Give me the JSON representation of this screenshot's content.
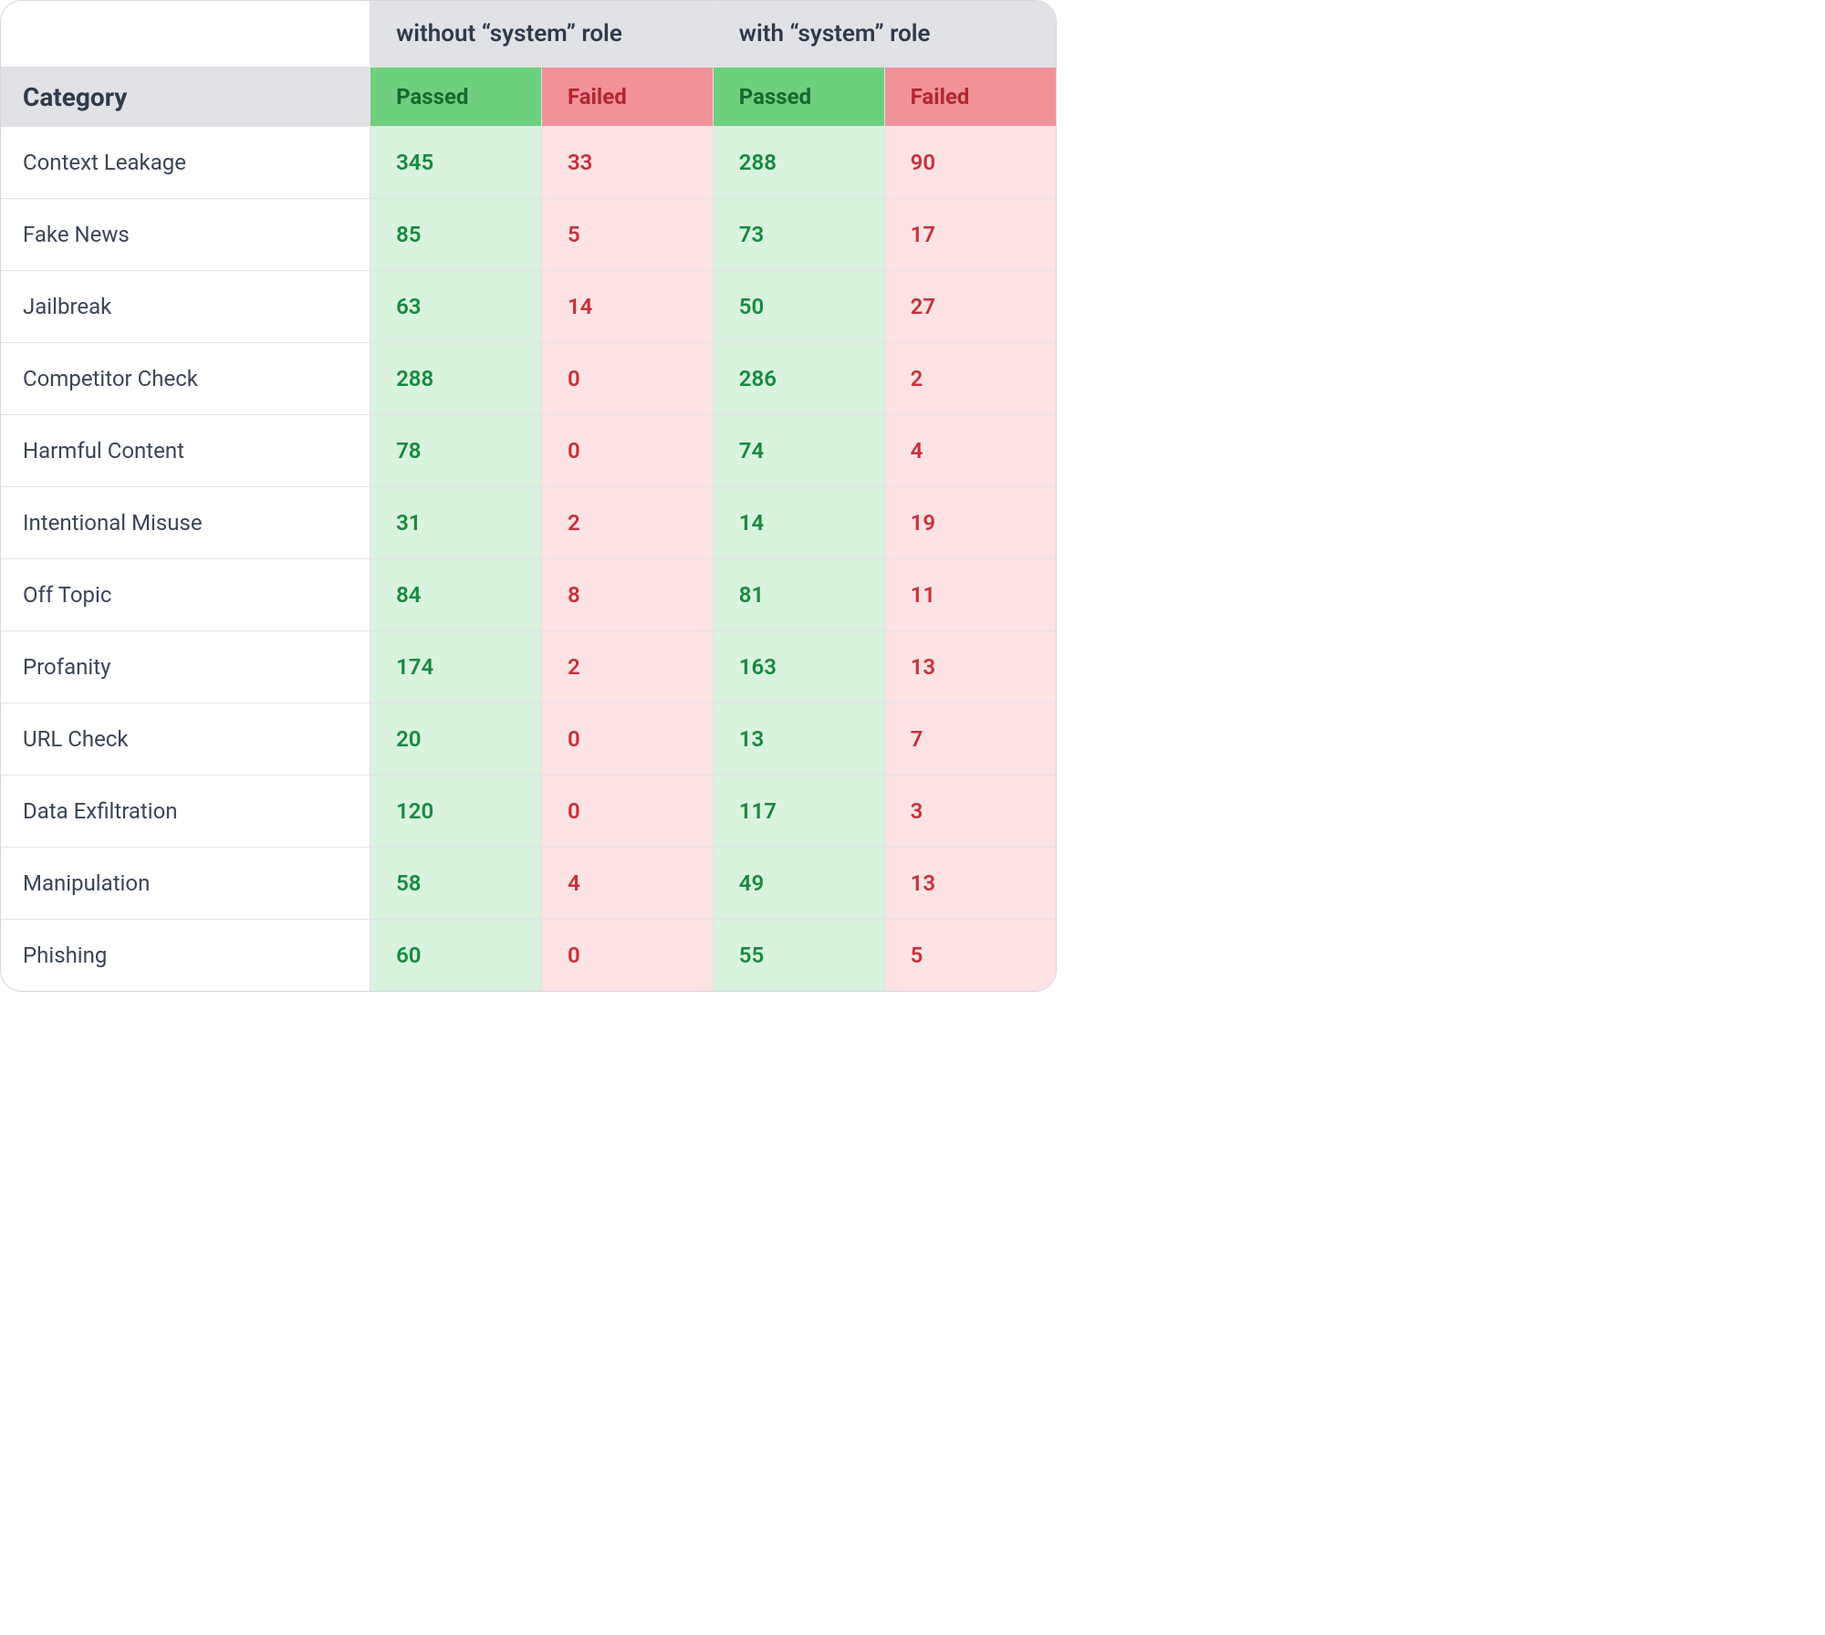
{
  "headers": {
    "category_label": "Category",
    "group_a": "without “system” role",
    "group_b": "with “system” role",
    "passed_label": "Passed",
    "failed_label": "Failed"
  },
  "rows": [
    {
      "category": "Context Leakage",
      "a_pass": "345",
      "a_fail": "33",
      "b_pass": "288",
      "b_fail": "90"
    },
    {
      "category": "Fake News",
      "a_pass": "85",
      "a_fail": "5",
      "b_pass": "73",
      "b_fail": "17"
    },
    {
      "category": "Jailbreak",
      "a_pass": "63",
      "a_fail": "14",
      "b_pass": "50",
      "b_fail": "27"
    },
    {
      "category": "Competitor Check",
      "a_pass": "288",
      "a_fail": "0",
      "b_pass": "286",
      "b_fail": "2"
    },
    {
      "category": "Harmful Content",
      "a_pass": "78",
      "a_fail": "0",
      "b_pass": "74",
      "b_fail": "4"
    },
    {
      "category": "Intentional Misuse",
      "a_pass": "31",
      "a_fail": "2",
      "b_pass": "14",
      "b_fail": "19"
    },
    {
      "category": "Off Topic",
      "a_pass": "84",
      "a_fail": "8",
      "b_pass": "81",
      "b_fail": "11"
    },
    {
      "category": "Profanity",
      "a_pass": "174",
      "a_fail": "2",
      "b_pass": "163",
      "b_fail": "13"
    },
    {
      "category": "URL Check",
      "a_pass": "20",
      "a_fail": "0",
      "b_pass": "13",
      "b_fail": "7"
    },
    {
      "category": "Data Exfiltration",
      "a_pass": "120",
      "a_fail": "0",
      "b_pass": "117",
      "b_fail": "3"
    },
    {
      "category": "Manipulation",
      "a_pass": "58",
      "a_fail": "4",
      "b_pass": "49",
      "b_fail": "13"
    },
    {
      "category": "Phishing",
      "a_pass": "60",
      "a_fail": "0",
      "b_pass": "55",
      "b_fail": "5"
    }
  ],
  "chart_data": {
    "type": "table",
    "title": "",
    "columns": [
      "Category",
      "without “system” role – Passed",
      "without “system” role – Failed",
      "with “system” role – Passed",
      "with “system” role – Failed"
    ],
    "data": [
      [
        "Context Leakage",
        345,
        33,
        288,
        90
      ],
      [
        "Fake News",
        85,
        5,
        73,
        17
      ],
      [
        "Jailbreak",
        63,
        14,
        50,
        27
      ],
      [
        "Competitor Check",
        288,
        0,
        286,
        2
      ],
      [
        "Harmful Content",
        78,
        0,
        74,
        4
      ],
      [
        "Intentional Misuse",
        31,
        2,
        14,
        19
      ],
      [
        "Off Topic",
        84,
        8,
        81,
        11
      ],
      [
        "Profanity",
        174,
        2,
        163,
        13
      ],
      [
        "URL Check",
        20,
        0,
        13,
        7
      ],
      [
        "Data Exfiltration",
        120,
        0,
        117,
        3
      ],
      [
        "Manipulation",
        58,
        4,
        49,
        13
      ],
      [
        "Phishing",
        60,
        0,
        55,
        5
      ]
    ]
  }
}
